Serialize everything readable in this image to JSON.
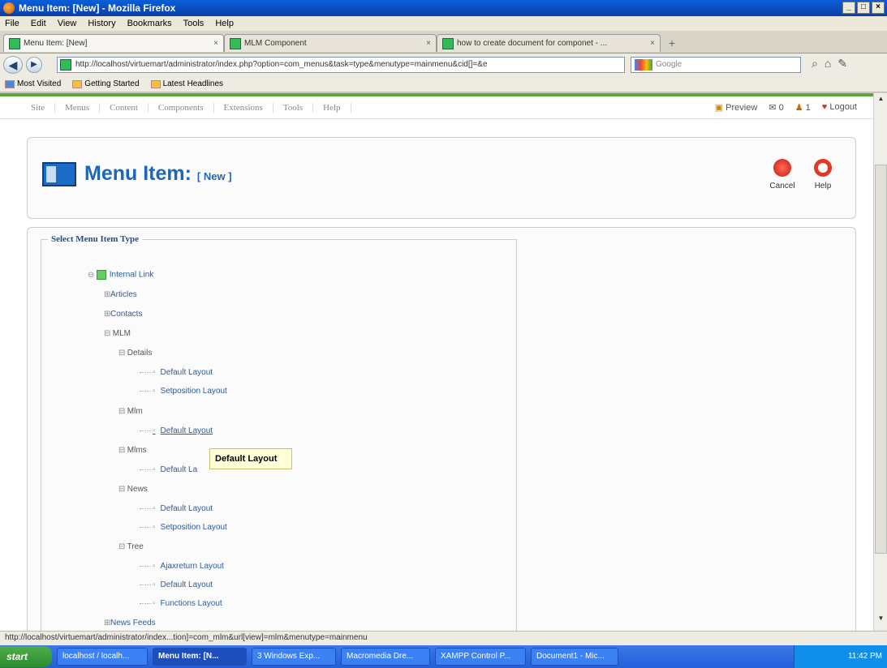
{
  "window": {
    "title": "Menu Item: [New] - Mozilla Firefox",
    "controls": [
      "_",
      "□",
      "×"
    ]
  },
  "menubar": [
    "File",
    "Edit",
    "View",
    "History",
    "Bookmarks",
    "Tools",
    "Help"
  ],
  "tabs": [
    {
      "label": "Menu Item: [New]",
      "close": "×"
    },
    {
      "label": "MLM Component",
      "close": "×"
    },
    {
      "label": "how to create document for componet - ...",
      "close": "×"
    }
  ],
  "newtab": "+",
  "nav": {
    "url": "http://localhost/virtuemart/administrator/index.php?option=com_menus&task=type&menutype=mainmenu&cid[]=&e",
    "search_placeholder": "Google"
  },
  "bookmarks": [
    "Most Visited",
    "Getting Started",
    "Latest Headlines"
  ],
  "joomla_menu": [
    "Site",
    "Menus",
    "Content",
    "Components",
    "Extensions",
    "Tools",
    "Help"
  ],
  "joomla_right": {
    "preview": "Preview",
    "messages": "0",
    "users": "1",
    "logout": "Logout"
  },
  "page": {
    "title": "Menu Item:",
    "subtitle": "[ New ]",
    "cancel": "Cancel",
    "help": "Help"
  },
  "legend": "Select Menu Item Type",
  "tree": {
    "internal_link": "Internal Link",
    "articles": "Articles",
    "contacts": "Contacts",
    "mlm": "MLM",
    "details": "Details",
    "details_default": "Default Layout",
    "details_setposition": "Setposition Layout",
    "mlm_node": "Mlm",
    "mlm_default": "Default Layout",
    "mlms": "Mlms",
    "mlms_default": "Default La",
    "news": "News",
    "news_default": "Default Layout",
    "news_setposition": "Setposition Layout",
    "tree": "Tree",
    "tree_ajax": "Ajaxreturn Layout",
    "tree_default": "Default Layout",
    "tree_functions": "Functions Layout",
    "newsfeeds": "News Feeds"
  },
  "tooltip": "Default Layout",
  "status": "http://localhost/virtuemart/administrator/index...tion]=com_mlm&url[view]=mlm&menutype=mainmenu",
  "taskbar": {
    "start": "start",
    "tasks": [
      "localhost / localh...",
      "Menu Item: [N...",
      "3 Windows Exp...",
      "Macromedia Dre...",
      "XAMPP Control P...",
      "Document1 - Mic..."
    ],
    "clock": "11:42 PM"
  }
}
